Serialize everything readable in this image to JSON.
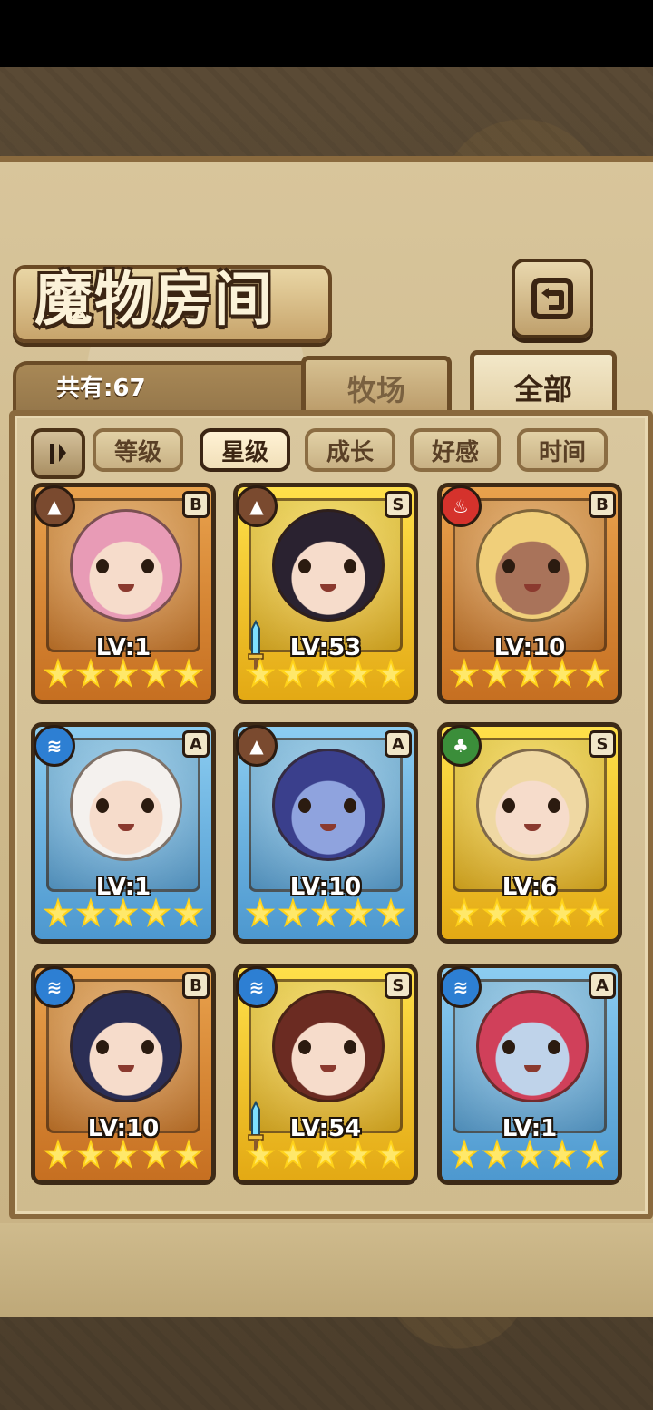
{
  "header": {
    "title": "魔物房间",
    "back_icon": "return-arrow-icon",
    "total_count": "共有:67"
  },
  "tabs": [
    {
      "label": "牧场",
      "selected": false
    },
    {
      "label": "全部",
      "selected": true
    }
  ],
  "filters": {
    "sort_toggle_icon": "sort-order-icon",
    "options": [
      {
        "label": "等级",
        "active": false
      },
      {
        "label": "星级",
        "active": true
      },
      {
        "label": "成长",
        "active": false
      },
      {
        "label": "好感",
        "active": false
      },
      {
        "label": "时间",
        "active": false
      }
    ]
  },
  "cards": [
    {
      "level": "LV:1",
      "rank": "B",
      "element": "earth-icon",
      "frame": "bronze",
      "stars": 5,
      "weapon": false,
      "colors": {
        "hair": "#e89bb6",
        "skin": "#f6dccb"
      }
    },
    {
      "level": "LV:53",
      "rank": "S",
      "element": "earth-icon",
      "frame": "gold",
      "stars": 5,
      "weapon": true,
      "colors": {
        "hair": "#2a2230",
        "skin": "#f6dccb"
      }
    },
    {
      "level": "LV:10",
      "rank": "B",
      "element": "fire-icon",
      "frame": "bronze",
      "stars": 5,
      "weapon": false,
      "colors": {
        "hair": "#f0cf7a",
        "skin": "#a9735a"
      }
    },
    {
      "level": "LV:1",
      "rank": "A",
      "element": "water-icon",
      "frame": "blue",
      "stars": 5,
      "weapon": false,
      "colors": {
        "hair": "#f4f1ee",
        "skin": "#f6dccb"
      }
    },
    {
      "level": "LV:10",
      "rank": "A",
      "element": "earth-icon",
      "frame": "blue",
      "stars": 5,
      "weapon": false,
      "colors": {
        "hair": "#3a3f8c",
        "skin": "#8fa3de"
      }
    },
    {
      "level": "LV:6",
      "rank": "S",
      "element": "wood-icon",
      "frame": "gold",
      "stars": 5,
      "weapon": false,
      "colors": {
        "hair": "#efd8a3",
        "skin": "#f6dccb"
      }
    },
    {
      "level": "LV:10",
      "rank": "B",
      "element": "water-icon",
      "frame": "bronze",
      "stars": 5,
      "weapon": false,
      "colors": {
        "hair": "#2b2e55",
        "skin": "#f6dccb"
      }
    },
    {
      "level": "LV:54",
      "rank": "S",
      "element": "water-icon",
      "frame": "gold",
      "stars": 5,
      "weapon": true,
      "colors": {
        "hair": "#6b2b22",
        "skin": "#f6dccb"
      }
    },
    {
      "level": "LV:1",
      "rank": "A",
      "element": "water-icon",
      "frame": "blue",
      "stars": 5,
      "weapon": false,
      "colors": {
        "hair": "#d0405a",
        "skin": "#bfd3ea"
      }
    }
  ]
}
